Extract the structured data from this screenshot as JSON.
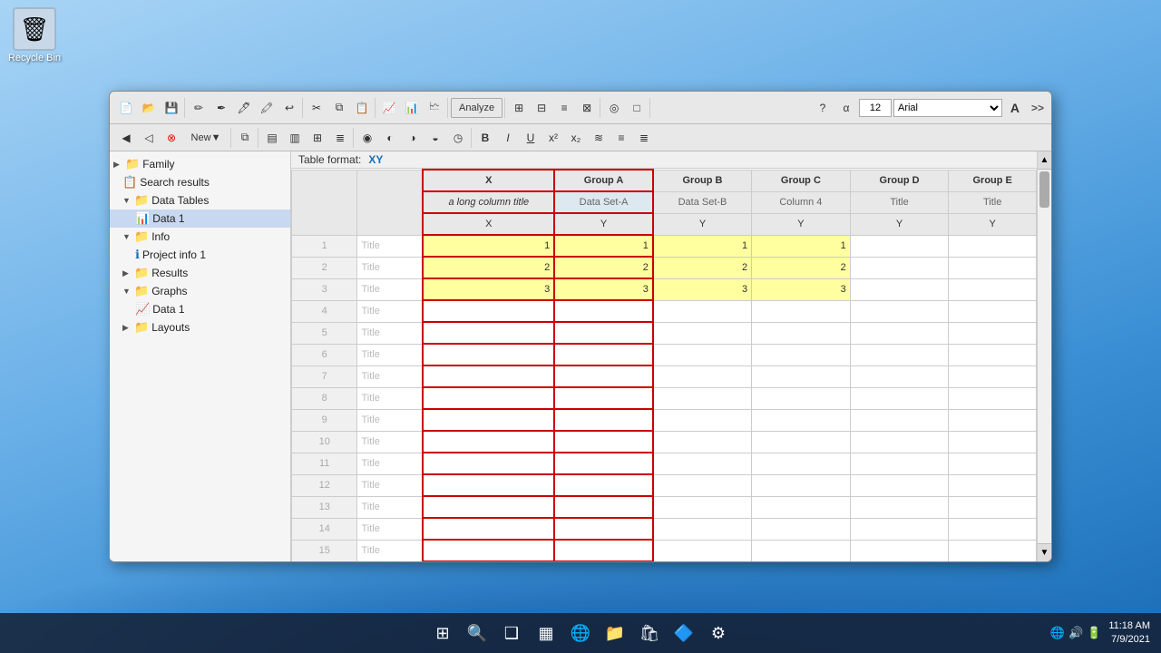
{
  "desktop": {
    "recycle_bin_label": "Recycle Bin",
    "recycle_bin_icon": "🗑"
  },
  "taskbar": {
    "icons": [
      {
        "name": "windows-start",
        "symbol": "⊞"
      },
      {
        "name": "search",
        "symbol": "🔍"
      },
      {
        "name": "task-view",
        "symbol": "❑"
      },
      {
        "name": "widgets",
        "symbol": "▦"
      },
      {
        "name": "edge",
        "symbol": "🌐"
      },
      {
        "name": "file-explorer",
        "symbol": "📁"
      },
      {
        "name": "store",
        "symbol": "🛍"
      },
      {
        "name": "network",
        "symbol": "🔷"
      },
      {
        "name": "settings",
        "symbol": "⚙"
      }
    ],
    "time": "11:18 AM",
    "date": "7/9/2021"
  },
  "toolbar": {
    "font_name": "Arial",
    "font_size": "12",
    "analyze_label": "Analyze",
    "new_label": "New",
    "more_label": ">>"
  },
  "sidebar": {
    "items": [
      {
        "id": "family",
        "label": "Family",
        "level": 0,
        "icon": "📁",
        "expanded": true
      },
      {
        "id": "search-results",
        "label": "Search results",
        "level": 1,
        "icon": "📋",
        "expanded": false
      },
      {
        "id": "data-tables",
        "label": "Data Tables",
        "level": 1,
        "icon": "📁",
        "expanded": true
      },
      {
        "id": "data1",
        "label": "Data 1",
        "level": 2,
        "icon": "📊",
        "selected": true
      },
      {
        "id": "info",
        "label": "Info",
        "level": 1,
        "icon": "📁",
        "expanded": true
      },
      {
        "id": "project-info-1",
        "label": "Project info 1",
        "level": 2,
        "icon": "ℹ",
        "expanded": false
      },
      {
        "id": "results",
        "label": "Results",
        "level": 1,
        "icon": "📁",
        "expanded": false
      },
      {
        "id": "graphs",
        "label": "Graphs",
        "level": 1,
        "icon": "📁",
        "expanded": true
      },
      {
        "id": "graphs-data1",
        "label": "Data 1",
        "level": 2,
        "icon": "📈",
        "expanded": false
      },
      {
        "id": "layouts",
        "label": "Layouts",
        "level": 1,
        "icon": "📁",
        "expanded": false
      }
    ]
  },
  "table": {
    "format_label": "Table format:",
    "format_value": "XY",
    "columns": [
      {
        "group": "",
        "group_label": "X",
        "sub_label": "a long column title",
        "type_label": "X",
        "selected": true
      },
      {
        "group": "Group A",
        "group_label": "Group A",
        "sub_label": "Data Set-A",
        "type_label": "Y",
        "selected": true
      },
      {
        "group": "Group B",
        "group_label": "Group B",
        "sub_label": "Data Set-B",
        "type_label": "Y",
        "selected": false
      },
      {
        "group": "Group C",
        "group_label": "Group C",
        "sub_label": "Column 4",
        "type_label": "Y",
        "selected": false
      },
      {
        "group": "Group D",
        "group_label": "Group D",
        "sub_label": "Title",
        "type_label": "Y",
        "selected": false
      },
      {
        "group": "Group E",
        "group_label": "Group E",
        "sub_label": "Title",
        "type_label": "Y",
        "selected": false
      }
    ],
    "rows": [
      {
        "num": 1,
        "row_label": "Title",
        "values": [
          1,
          1,
          1,
          1,
          null,
          null
        ],
        "highlighted": true
      },
      {
        "num": 2,
        "row_label": "Title",
        "values": [
          2,
          2,
          2,
          2,
          null,
          null
        ],
        "highlighted": true
      },
      {
        "num": 3,
        "row_label": "Title",
        "values": [
          3,
          3,
          3,
          3,
          null,
          null
        ],
        "highlighted": true
      },
      {
        "num": 4,
        "row_label": "Title",
        "values": [
          null,
          null,
          null,
          null,
          null,
          null
        ],
        "highlighted": false
      },
      {
        "num": 5,
        "row_label": "Title",
        "values": [
          null,
          null,
          null,
          null,
          null,
          null
        ],
        "highlighted": false
      },
      {
        "num": 6,
        "row_label": "Title",
        "values": [
          null,
          null,
          null,
          null,
          null,
          null
        ],
        "highlighted": false
      },
      {
        "num": 7,
        "row_label": "Title",
        "values": [
          null,
          null,
          null,
          null,
          null,
          null
        ],
        "highlighted": false
      },
      {
        "num": 8,
        "row_label": "Title",
        "values": [
          null,
          null,
          null,
          null,
          null,
          null
        ],
        "highlighted": false
      },
      {
        "num": 9,
        "row_label": "Title",
        "values": [
          null,
          null,
          null,
          null,
          null,
          null
        ],
        "highlighted": false
      },
      {
        "num": 10,
        "row_label": "Title",
        "values": [
          null,
          null,
          null,
          null,
          null,
          null
        ],
        "highlighted": false
      },
      {
        "num": 11,
        "row_label": "Title",
        "values": [
          null,
          null,
          null,
          null,
          null,
          null
        ],
        "highlighted": false
      },
      {
        "num": 12,
        "row_label": "Title",
        "values": [
          null,
          null,
          null,
          null,
          null,
          null
        ],
        "highlighted": false
      },
      {
        "num": 13,
        "row_label": "Title",
        "values": [
          null,
          null,
          null,
          null,
          null,
          null
        ],
        "highlighted": false
      },
      {
        "num": 14,
        "row_label": "Title",
        "values": [
          null,
          null,
          null,
          null,
          null,
          null
        ],
        "highlighted": false
      },
      {
        "num": 15,
        "row_label": "Title",
        "values": [
          null,
          null,
          null,
          null,
          null,
          null
        ],
        "highlighted": false
      }
    ]
  }
}
